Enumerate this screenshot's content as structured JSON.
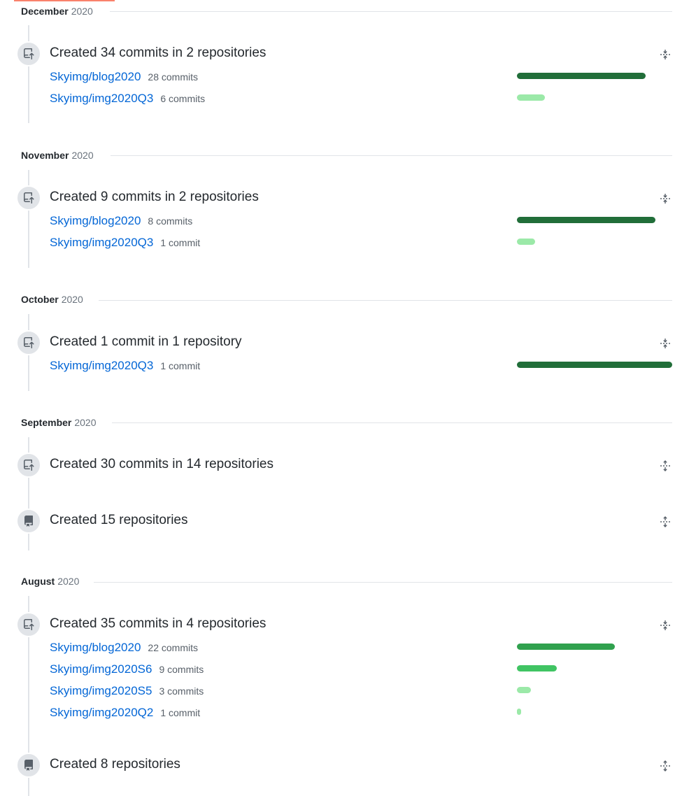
{
  "colors": {
    "link": "#0366d6",
    "text": "#24292e",
    "muted": "#586069",
    "badge_bg": "#e1e4e8",
    "bar_dark": "#216e39",
    "bar_mid": "#30a14e",
    "bar_bright": "#40c463",
    "bar_light": "#9be9a8",
    "tab_accent": "#f9826c"
  },
  "icons": {
    "commit": "repo-push-icon",
    "repo": "repo-icon",
    "fold": "fold-icon",
    "unfold": "unfold-icon"
  },
  "months": [
    {
      "name": "December",
      "year": "2020",
      "events": [
        {
          "type": "commits",
          "summary": "Created 34 commits in 2 repositories",
          "expanded": true,
          "repos": [
            {
              "name": "Skyimg/blog2020",
              "count": "28 commits",
              "share": 0.83
            },
            {
              "name": "Skyimg/img2020Q3",
              "count": "6 commits",
              "share": 0.18
            }
          ]
        }
      ]
    },
    {
      "name": "November",
      "year": "2020",
      "events": [
        {
          "type": "commits",
          "summary": "Created 9 commits in 2 repositories",
          "expanded": true,
          "repos": [
            {
              "name": "Skyimg/blog2020",
              "count": "8 commits",
              "share": 0.89
            },
            {
              "name": "Skyimg/img2020Q3",
              "count": "1 commit",
              "share": 0.12
            }
          ]
        }
      ]
    },
    {
      "name": "October",
      "year": "2020",
      "events": [
        {
          "type": "commits",
          "summary": "Created 1 commit in 1 repository",
          "expanded": true,
          "repos": [
            {
              "name": "Skyimg/img2020Q3",
              "count": "1 commit",
              "share": 1.0
            }
          ]
        }
      ]
    },
    {
      "name": "September",
      "year": "2020",
      "events": [
        {
          "type": "commits",
          "summary": "Created 30 commits in 14 repositories",
          "expanded": false,
          "repos": []
        },
        {
          "type": "repos",
          "summary": "Created 15 repositories",
          "expanded": false,
          "repos": []
        }
      ]
    },
    {
      "name": "August",
      "year": "2020",
      "events": [
        {
          "type": "commits",
          "summary": "Created 35 commits in 4 repositories",
          "expanded": true,
          "repos": [
            {
              "name": "Skyimg/blog2020",
              "count": "22 commits",
              "share": 0.63
            },
            {
              "name": "Skyimg/img2020S6",
              "count": "9 commits",
              "share": 0.26
            },
            {
              "name": "Skyimg/img2020S5",
              "count": "3 commits",
              "share": 0.09
            },
            {
              "name": "Skyimg/img2020Q2",
              "count": "1 commit",
              "share": 0.03
            }
          ]
        },
        {
          "type": "repos",
          "summary": "Created 8 repositories",
          "expanded": false,
          "repos": []
        }
      ]
    }
  ]
}
